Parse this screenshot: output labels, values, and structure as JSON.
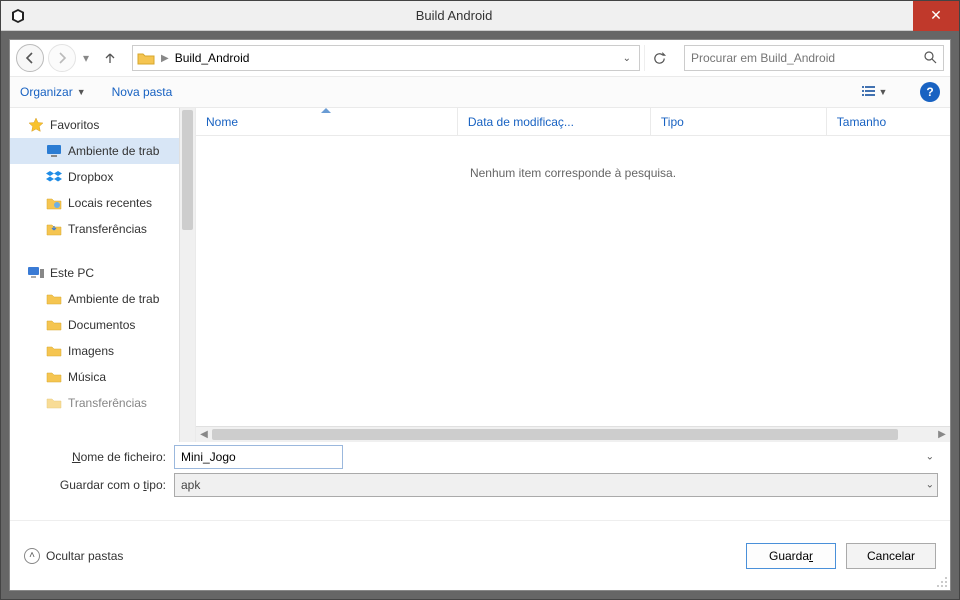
{
  "titlebar": {
    "title": "Build Android"
  },
  "nav": {
    "path_segment": "Build_Android",
    "search_placeholder": "Procurar em Build_Android"
  },
  "toolbar": {
    "organize": "Organizar",
    "new_folder": "Nova pasta"
  },
  "sidebar": {
    "favorites": {
      "label": "Favoritos",
      "items": [
        {
          "label": "Ambiente de trab",
          "icon": "desktop"
        },
        {
          "label": "Dropbox",
          "icon": "dropbox"
        },
        {
          "label": "Locais recentes",
          "icon": "recent"
        },
        {
          "label": "Transferências",
          "icon": "downloads"
        }
      ]
    },
    "thispc": {
      "label": "Este PC",
      "items": [
        {
          "label": "Ambiente de trab",
          "icon": "desktop-folder"
        },
        {
          "label": "Documentos",
          "icon": "documents"
        },
        {
          "label": "Imagens",
          "icon": "images"
        },
        {
          "label": "Música",
          "icon": "music"
        },
        {
          "label": "Transferências",
          "icon": "downloads"
        }
      ]
    }
  },
  "columns": {
    "name": "Nome",
    "date": "Data de modificaç...",
    "type": "Tipo",
    "size": "Tamanho"
  },
  "main": {
    "empty_message": "Nenhum item corresponde à pesquisa."
  },
  "form": {
    "filename_label_pre": "N",
    "filename_label_post": "ome de ficheiro:",
    "filename_value": "Mini_Jogo",
    "savetype_label": "Guardar com o ",
    "savetype_label_u": "t",
    "savetype_label_post": "ipo:",
    "savetype_value": "apk"
  },
  "footer": {
    "hide_folders": "Ocultar pastas",
    "save": "Guardar",
    "cancel": "Cancelar"
  }
}
